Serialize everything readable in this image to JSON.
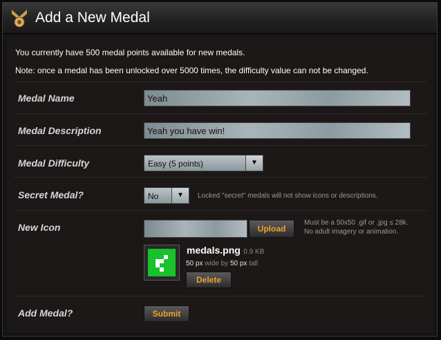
{
  "title": "Add a New Medal",
  "info": {
    "points_line": "You currently have 500 medal points available for new medals.",
    "note_line": "Note: once a medal has been unlocked over 5000 times, the difficulty value can not be changed."
  },
  "form": {
    "name": {
      "label": "Medal Name",
      "value": "Yeah"
    },
    "description": {
      "label": "Medal Description",
      "value": "Yeah you have win!"
    },
    "difficulty": {
      "label": "Medal Difficulty",
      "selected": "Easy (5 points)"
    },
    "secret": {
      "label": "Secret Medal?",
      "selected": "No",
      "hint": "Locked \"secret\" medals will not show icons or descriptions."
    },
    "icon": {
      "label": "New Icon",
      "upload_label": "Upload",
      "hint_line1": "Must be a 50x50 .gif or .jpg ≤ 28k.",
      "hint_line2": "No adult imagery or animation.",
      "file_name": "medals.png",
      "file_size": "0.9 KB",
      "width_value": "50 px",
      "wide_by": "wide by",
      "height_value": "50 px",
      "tall": "tall",
      "delete_label": "Delete"
    },
    "submit": {
      "label": "Add Medal?",
      "button_label": "Submit"
    }
  },
  "colors": {
    "accent": "#f0a030",
    "icon_green": "#18c22a"
  }
}
